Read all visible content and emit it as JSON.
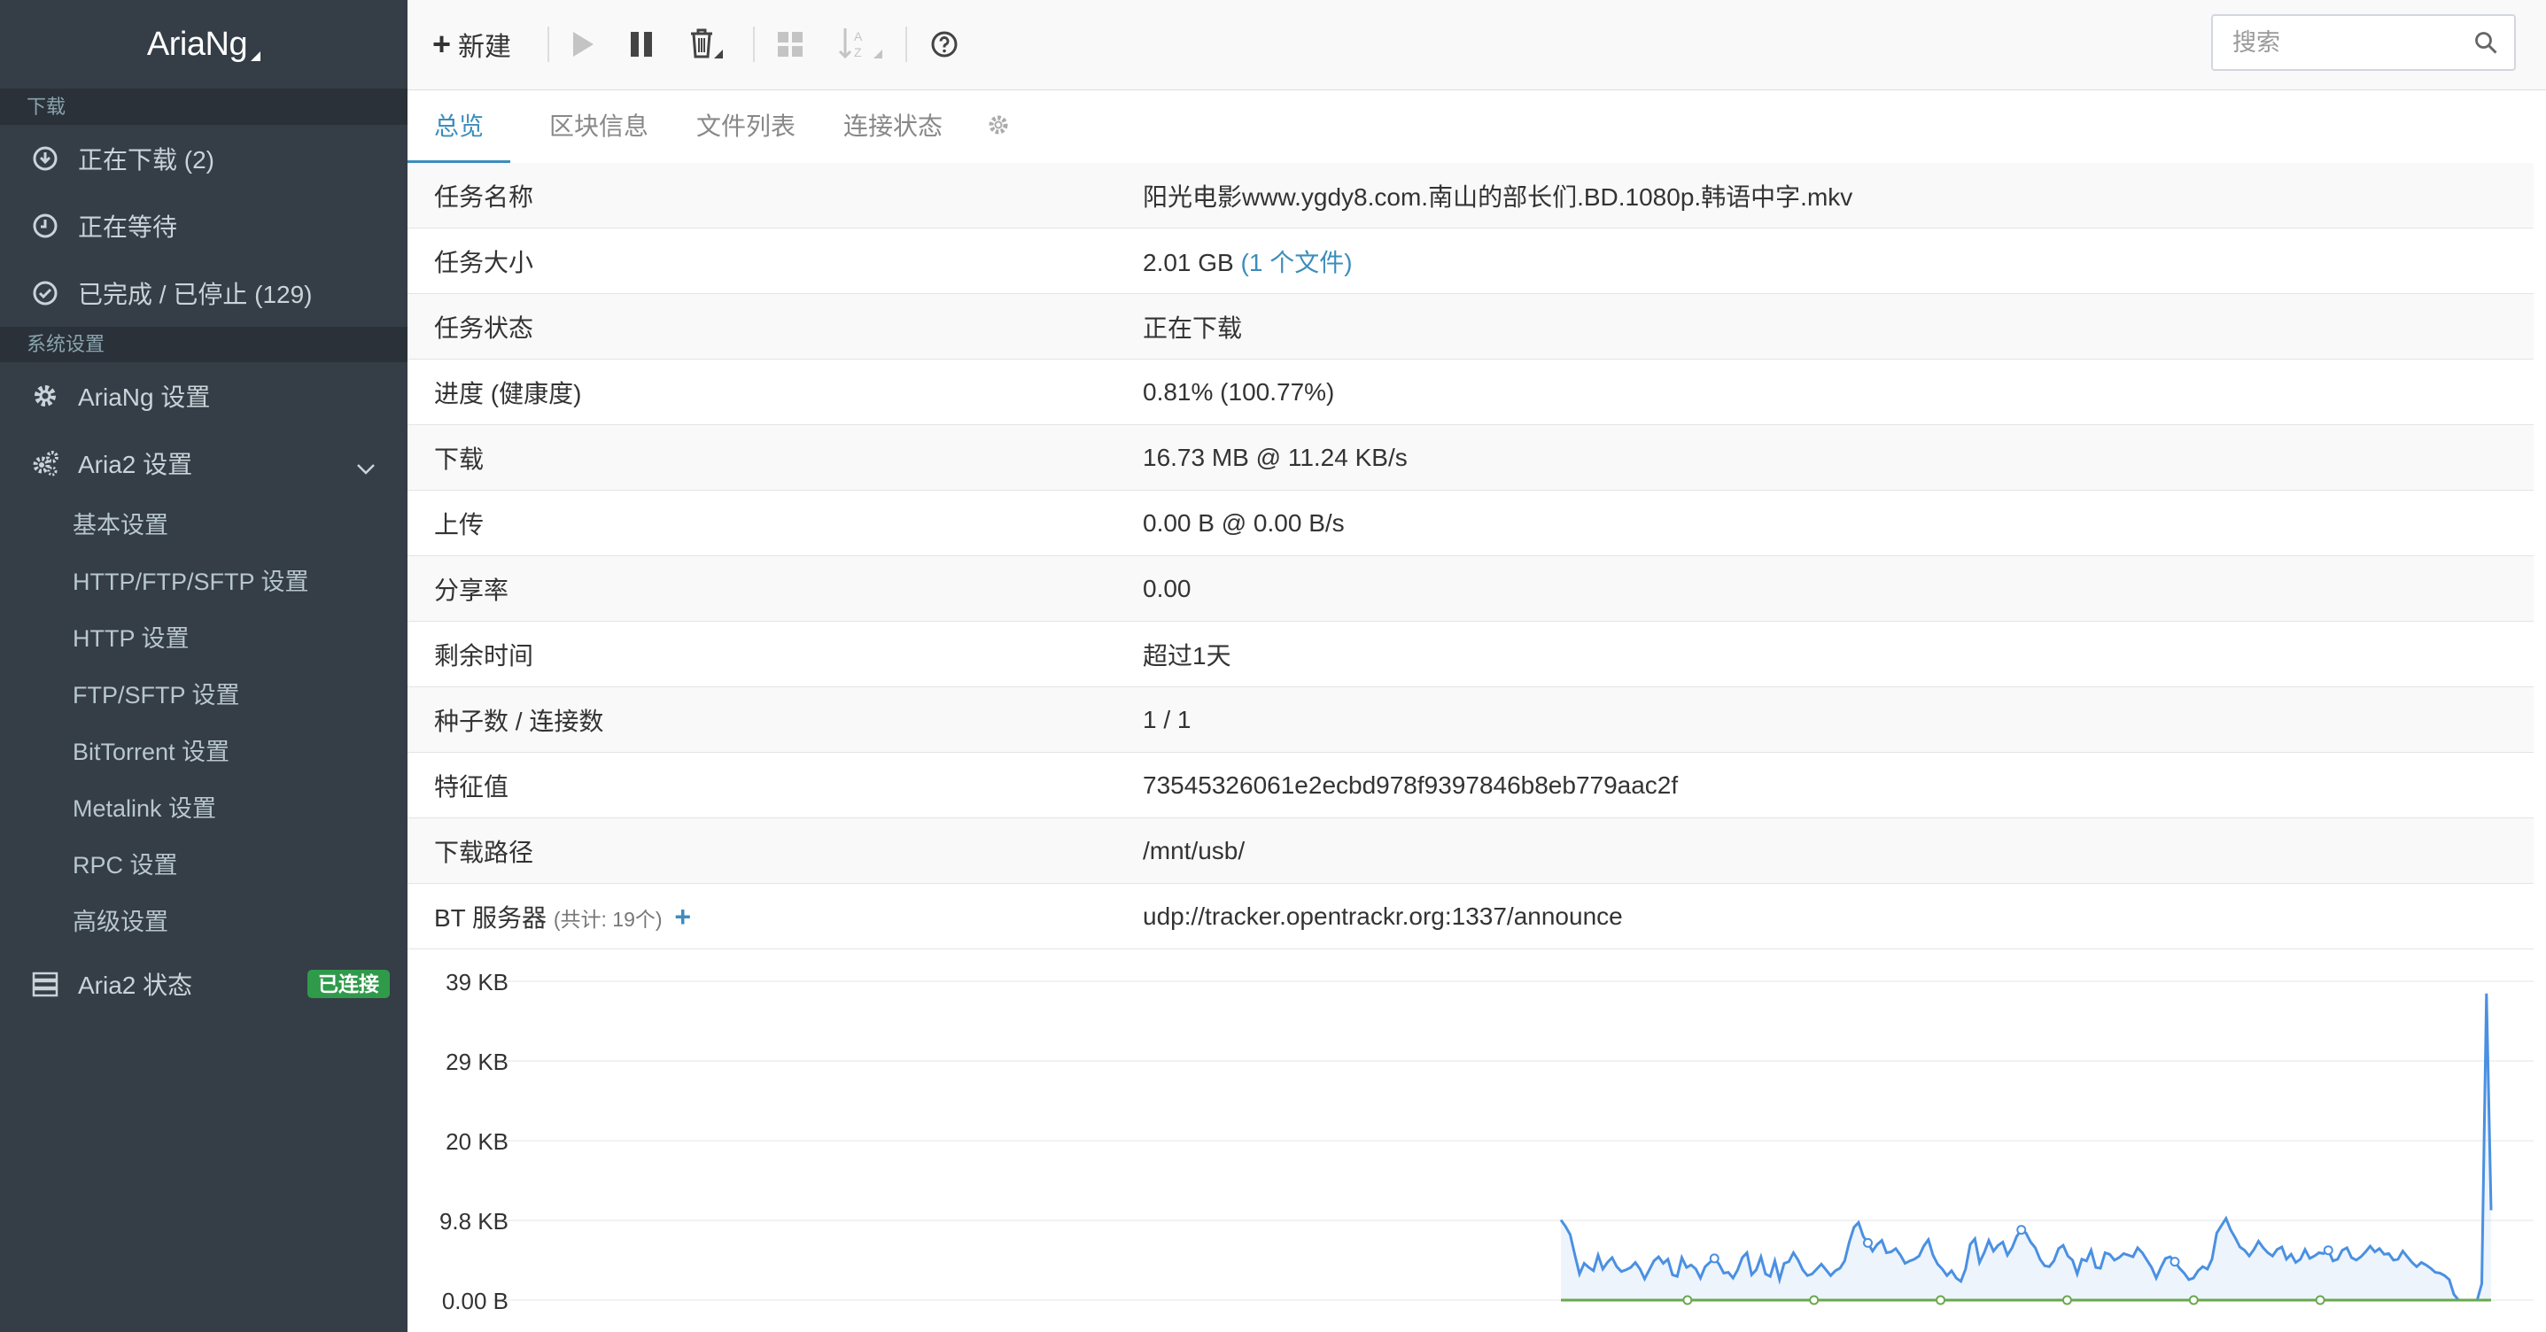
{
  "app": {
    "title": "AriaNg"
  },
  "sidebar": {
    "download_header": "下载",
    "downloads": [
      {
        "label": "正在下载 (2)",
        "icon": "download-circle-icon"
      },
      {
        "label": "正在等待",
        "icon": "clock-icon"
      },
      {
        "label": "已完成 / 已停止 (129)",
        "icon": "check-circle-icon"
      }
    ],
    "settings_header": "系统设置",
    "ariang_settings": "AriaNg 设置",
    "aria2_settings": "Aria2 设置",
    "aria2_sub": [
      "基本设置",
      "HTTP/FTP/SFTP 设置",
      "HTTP 设置",
      "FTP/SFTP 设置",
      "BitTorrent 设置",
      "Metalink 设置",
      "RPC 设置",
      "高级设置"
    ],
    "aria2_status": "Aria2 状态",
    "status_badge": "已连接"
  },
  "toolbar": {
    "new_label": "新建",
    "search_placeholder": "搜索"
  },
  "tabs": [
    "总览",
    "区块信息",
    "文件列表",
    "连接状态"
  ],
  "details": {
    "name": {
      "label": "任务名称",
      "value": "阳光电影www.ygdy8.com.南山的部长们.BD.1080p.韩语中字.mkv"
    },
    "size": {
      "label": "任务大小",
      "value": "2.01 GB",
      "files": "(1 个文件)"
    },
    "status": {
      "label": "任务状态",
      "value": "正在下载"
    },
    "progress": {
      "label": "进度 (健康度)",
      "value": "0.81% (100.77%)"
    },
    "download": {
      "label": "下载",
      "value": "16.73 MB @ 11.24 KB/s"
    },
    "upload": {
      "label": "上传",
      "value": "0.00 B @ 0.00 B/s"
    },
    "ratio": {
      "label": "分享率",
      "value": "0.00"
    },
    "remaining": {
      "label": "剩余时间",
      "value": "超过1天"
    },
    "peers": {
      "label": "种子数 / 连接数",
      "value": "1 / 1"
    },
    "hash": {
      "label": "特征值",
      "value": "73545326061e2ecbd978f9397846b8eb779aac2f"
    },
    "path": {
      "label": "下载路径",
      "value": "/mnt/usb/"
    },
    "trackers": {
      "label": "BT 服务器",
      "count": "(共计: 19个)",
      "value": "udp://tracker.opentrackr.org:1337/announce"
    }
  },
  "chart_data": {
    "type": "area",
    "y_ticks": [
      "39 KB",
      "29 KB",
      "20 KB",
      "9.8 KB",
      "0.00 B"
    ],
    "ylim": [
      0,
      39
    ],
    "grid": true,
    "series": [
      {
        "color": "#4a90e2",
        "values": [
          9.8,
          9,
          8,
          5.5,
          3.2,
          4.5,
          4,
          3.6,
          5.5,
          3.8,
          4.6,
          5.2,
          4.1,
          3.5,
          3.7,
          4,
          4.6,
          3.8,
          2.6,
          3.7,
          4.8,
          5.3,
          4.5,
          5,
          3.1,
          2.9,
          5.2,
          4,
          4.3,
          3.8,
          2.7,
          4.1,
          4.6,
          5.1,
          4.4,
          3.3,
          3.4,
          2.7,
          3.7,
          5.2,
          5.8,
          3.1,
          3.7,
          5.3,
          3.2,
          2.9,
          4.8,
          2.5,
          4.5,
          4.7,
          5.8,
          4.9,
          3.7,
          3,
          3.2,
          3.8,
          4.4,
          3.7,
          3,
          3.6,
          3.9,
          4.8,
          7.1,
          8.9,
          9.5,
          7.8,
          7,
          6,
          6.8,
          7.3,
          5.8,
          5.9,
          6.3,
          5.5,
          4.5,
          4.8,
          5,
          5.4,
          6.6,
          7.4,
          5.5,
          4.4,
          3.8,
          3,
          3.6,
          2.7,
          2.3,
          3.8,
          6.8,
          7.5,
          4.6,
          5.8,
          7.3,
          6,
          6.7,
          7.1,
          5.5,
          6.4,
          7.8,
          8.6,
          8.2,
          7.1,
          6.4,
          5,
          4.2,
          4.1,
          4.8,
          6.3,
          6.7,
          5.4,
          4.9,
          3.2,
          5,
          4.8,
          6.1,
          4,
          3.9,
          5.8,
          5.6,
          4.9,
          5.2,
          5.7,
          5.5,
          5.3,
          6.4,
          5.8,
          4.9,
          4,
          2.7,
          4,
          5.1,
          5.3,
          4.7,
          3.9,
          3.3,
          2.5,
          2.7,
          3.6,
          4.1,
          3.8,
          5,
          8.2,
          9.1,
          10,
          8.6,
          7.6,
          6.5,
          6.1,
          5.4,
          6.2,
          7.2,
          6.4,
          5.8,
          5.4,
          6.2,
          6.5,
          5,
          5.6,
          4.6,
          5,
          6.2,
          5.1,
          5.4,
          5.8,
          5.7,
          6.1,
          4.8,
          5,
          6.1,
          6.4,
          5.2,
          4.9,
          5.3,
          5.9,
          6.6,
          5.9,
          6.3,
          5.6,
          5.7,
          4.9,
          5,
          6,
          5.3,
          4.6,
          4.1,
          4.6,
          4.3,
          3.9,
          3.4,
          3.3,
          3,
          2.5,
          0.7,
          0,
          0,
          0,
          0,
          0,
          2,
          37.5,
          11
        ]
      },
      {
        "color": "#6aa84f",
        "values": [
          0,
          0,
          0,
          0,
          0,
          0,
          0,
          0
        ]
      }
    ]
  }
}
